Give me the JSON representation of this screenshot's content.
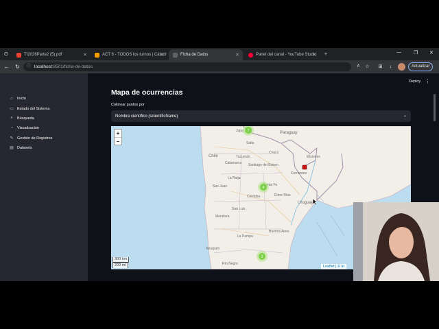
{
  "browser": {
    "tabs": [
      {
        "title": "TI2026Parte2 (5).pdf",
        "active": false
      },
      {
        "title": "ACT 6 - TODOS los turnos | Cátedr",
        "active": false
      },
      {
        "title": "Ficha de Datos",
        "active": true
      },
      {
        "title": "Panel del canal - YouTube Studio",
        "active": false
      }
    ],
    "url_host": "localhost",
    "url_path": ":8501/ficha-de-datos",
    "update_label": "Actualizar"
  },
  "app": {
    "header": {
      "deploy_label": "Deploy",
      "menu_glyph": "⋮"
    },
    "sidebar": {
      "items": [
        {
          "label": "Inicio",
          "icon": "home-icon"
        },
        {
          "label": "Estado del Sistema",
          "icon": "monitor-icon"
        },
        {
          "label": "Búsqueda",
          "icon": "search-icon"
        },
        {
          "label": "Visualización",
          "icon": "chart-icon"
        },
        {
          "label": "Gestión de Registros",
          "icon": "edit-icon"
        },
        {
          "label": "Datasets",
          "icon": "dataset-icon"
        }
      ]
    },
    "main": {
      "title": "Mapa de ocurrencias",
      "color_label": "Colorear puntos por",
      "color_select_value": "Nombre científico (scientificName)"
    },
    "map": {
      "zoom_in": "+",
      "zoom_out": "−",
      "scale_km": "300 km",
      "scale_mi": "200 mi",
      "attribution": "Leaflet | © In",
      "place_labels": [
        "Jujuy",
        "Salta",
        "Paraguay",
        "Chile",
        "Tucumán",
        "Chaco",
        "Misiones",
        "Catamarca",
        "Santiago del Estero",
        "La Rioja",
        "Corrientes",
        "San Juan",
        "Santa Fe",
        "Córdoba",
        "Entre Ríos",
        "Uruguay",
        "Mendoza",
        "San Luis",
        "Buenos Aires",
        "La Pampa",
        "Neuquén",
        "Río Negro"
      ],
      "clusters": [
        {
          "count": "7",
          "color": "#8fd14f"
        },
        {
          "count": "4",
          "color": "#8fd14f"
        },
        {
          "count": "2",
          "color": "#8fd14f"
        }
      ],
      "marker_color": "#cc1111"
    }
  },
  "colors": {
    "app_bg": "#0e1117",
    "sidebar_bg": "#262730",
    "land": "#f2efe9",
    "water": "#bcdcef"
  }
}
